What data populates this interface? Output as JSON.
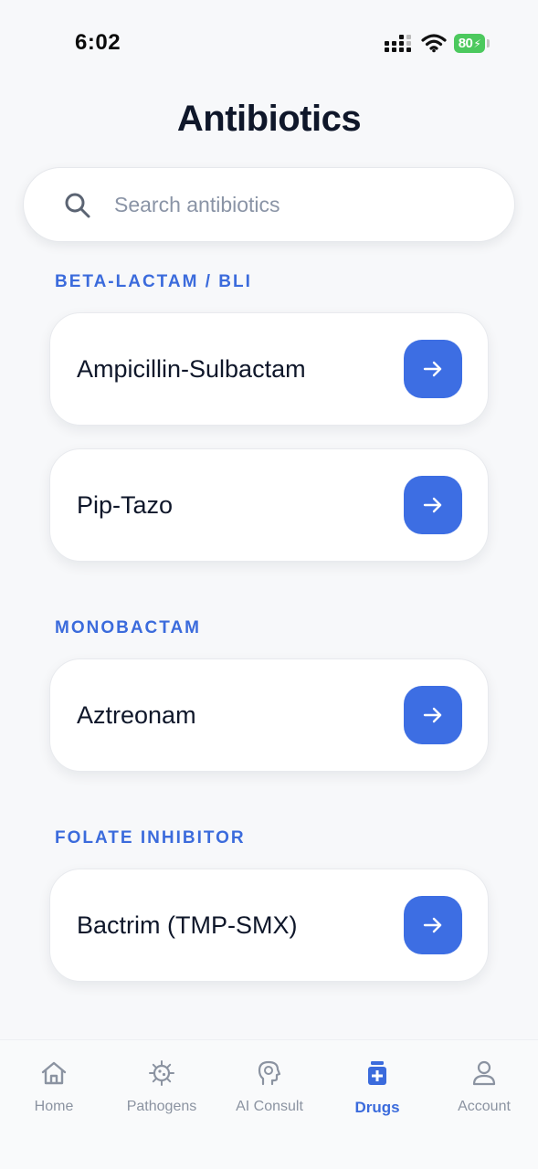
{
  "status_bar": {
    "time": "6:02",
    "battery": "80",
    "icons": [
      "signal-icon",
      "wifi-icon",
      "battery-icon"
    ]
  },
  "page": {
    "title": "Antibiotics"
  },
  "search": {
    "placeholder": "Search antibiotics",
    "value": "",
    "icon": "search-icon"
  },
  "sections": [
    {
      "header": "BETA-LACTAM / BLI",
      "items": [
        {
          "name": "Ampicillin-Sulbactam",
          "icon": "arrow-right-icon"
        },
        {
          "name": "Pip-Tazo",
          "icon": "arrow-right-icon"
        }
      ]
    },
    {
      "header": "MONOBACTAM",
      "items": [
        {
          "name": "Aztreonam",
          "icon": "arrow-right-icon"
        }
      ]
    },
    {
      "header": "FOLATE INHIBITOR",
      "items": [
        {
          "name": "Bactrim (TMP-SMX)",
          "icon": "arrow-right-icon"
        }
      ]
    }
  ],
  "bottom_nav": {
    "items": [
      {
        "label": "Home",
        "icon": "home-icon",
        "active": false
      },
      {
        "label": "Pathogens",
        "icon": "virus-icon",
        "active": false
      },
      {
        "label": "AI Consult",
        "icon": "brain-head-icon",
        "active": false
      },
      {
        "label": "Drugs",
        "icon": "medicine-bottle-icon",
        "active": true
      },
      {
        "label": "Account",
        "icon": "user-icon",
        "active": false
      }
    ]
  },
  "colors": {
    "accent": "#3d6ee3",
    "section_header": "#3b6bdc",
    "background": "#f7f8fa",
    "battery": "#4cc95e",
    "nav_inactive": "#8b93a1"
  }
}
